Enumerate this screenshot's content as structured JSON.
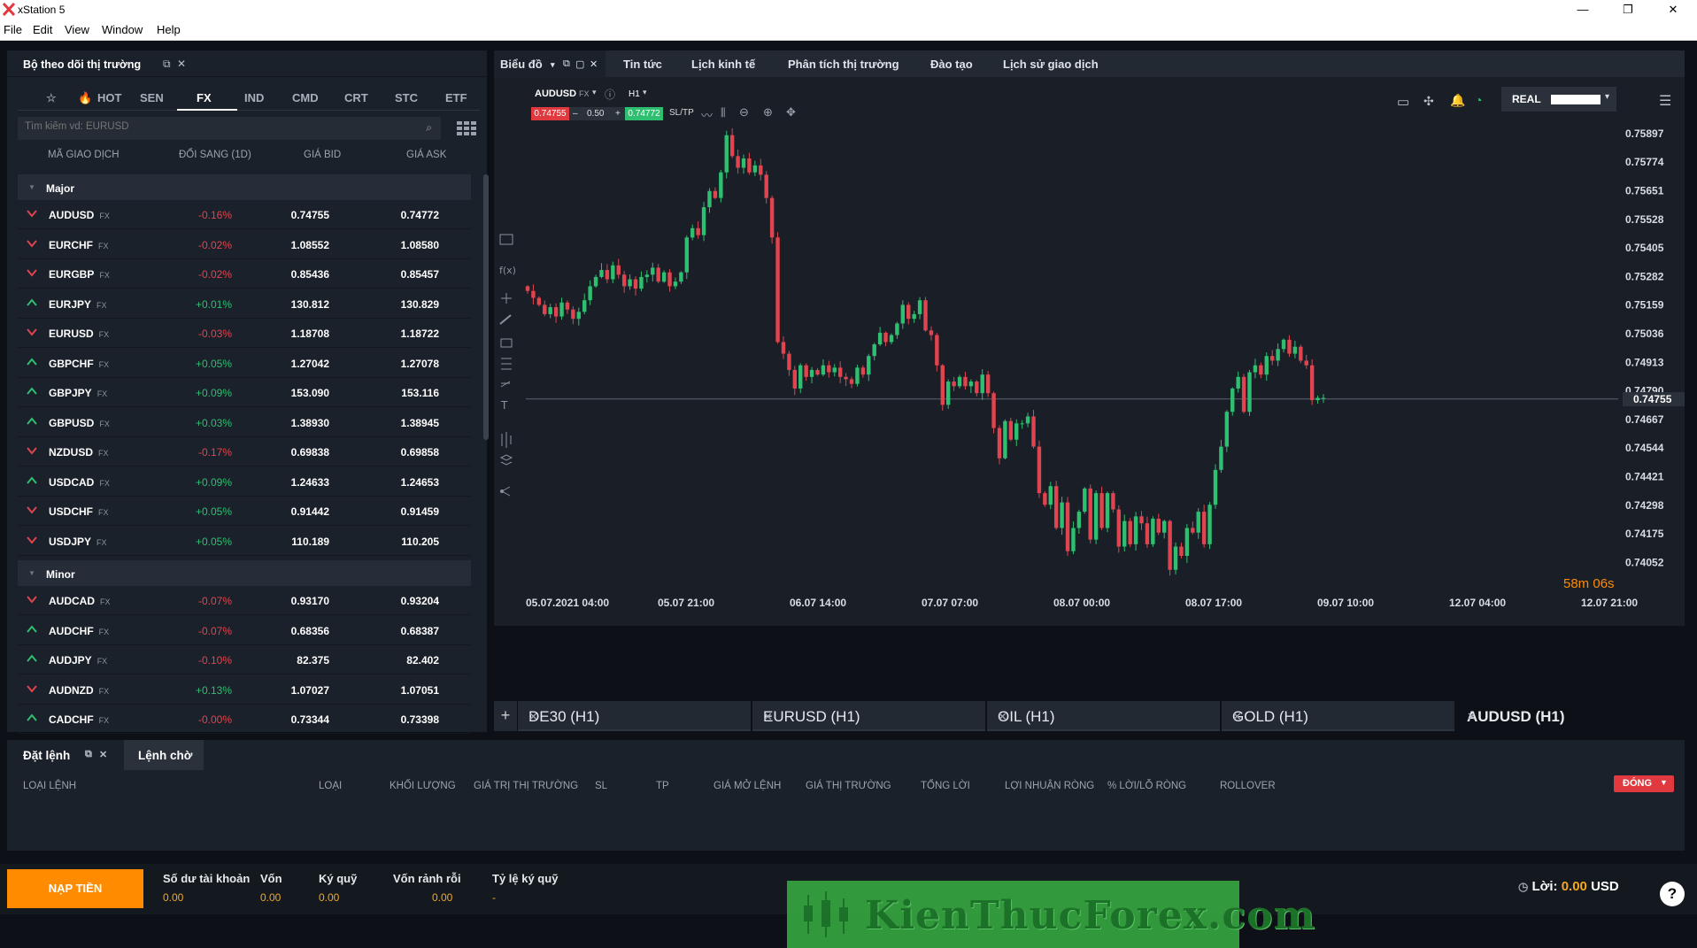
{
  "window": {
    "title": "xStation 5",
    "minimize": "—",
    "maximize": "❐",
    "close": "✕"
  },
  "menu": [
    "File",
    "Edit",
    "View",
    "Window",
    "Help"
  ],
  "watchlist": {
    "title": "Bộ theo dõi thị trường",
    "tabs": [
      "HOT",
      "SEN",
      "FX",
      "IND",
      "CMD",
      "CRT",
      "STC",
      "ETF"
    ],
    "active_tab": "FX",
    "search_placeholder": "Tìm kiếm vd: EURUSD",
    "columns": [
      "MÃ GIAO DỊCH",
      "ĐỔI SANG (1D)",
      "GIÁ BID",
      "GIÁ ASK"
    ],
    "groups": [
      {
        "name": "Major",
        "rows": [
          {
            "symbol": "AUDUSD",
            "type": "FX",
            "dir": "down",
            "change": "-0.16%",
            "bid": "0.74755",
            "ask": "0.74772"
          },
          {
            "symbol": "EURCHF",
            "type": "FX",
            "dir": "down",
            "change": "-0.02%",
            "bid": "1.08552",
            "ask": "1.08580"
          },
          {
            "symbol": "EURGBP",
            "type": "FX",
            "dir": "down",
            "change": "-0.02%",
            "bid": "0.85436",
            "ask": "0.85457"
          },
          {
            "symbol": "EURJPY",
            "type": "FX",
            "dir": "up",
            "change": "+0.01%",
            "bid": "130.812",
            "ask": "130.829"
          },
          {
            "symbol": "EURUSD",
            "type": "FX",
            "dir": "down",
            "change": "-0.03%",
            "bid": "1.18708",
            "ask": "1.18722"
          },
          {
            "symbol": "GBPCHF",
            "type": "FX",
            "dir": "up",
            "change": "+0.05%",
            "bid": "1.27042",
            "ask": "1.27078"
          },
          {
            "symbol": "GBPJPY",
            "type": "FX",
            "dir": "up",
            "change": "+0.09%",
            "bid": "153.090",
            "ask": "153.116"
          },
          {
            "symbol": "GBPUSD",
            "type": "FX",
            "dir": "up",
            "change": "+0.03%",
            "bid": "1.38930",
            "ask": "1.38945"
          },
          {
            "symbol": "NZDUSD",
            "type": "FX",
            "dir": "down",
            "change": "-0.17%",
            "bid": "0.69838",
            "ask": "0.69858"
          },
          {
            "symbol": "USDCAD",
            "type": "FX",
            "dir": "up",
            "change": "+0.09%",
            "bid": "1.24633",
            "ask": "1.24653"
          },
          {
            "symbol": "USDCHF",
            "type": "FX",
            "dir": "down",
            "change": "+0.05%",
            "bid": "0.91442",
            "ask": "0.91459"
          },
          {
            "symbol": "USDJPY",
            "type": "FX",
            "dir": "down",
            "change": "+0.05%",
            "bid": "110.189",
            "ask": "110.205"
          }
        ]
      },
      {
        "name": "Minor",
        "rows": [
          {
            "symbol": "AUDCAD",
            "type": "FX",
            "dir": "down",
            "change": "-0.07%",
            "bid": "0.93170",
            "ask": "0.93204"
          },
          {
            "symbol": "AUDCHF",
            "type": "FX",
            "dir": "up",
            "change": "-0.07%",
            "bid": "0.68356",
            "ask": "0.68387"
          },
          {
            "symbol": "AUDJPY",
            "type": "FX",
            "dir": "up",
            "change": "-0.10%",
            "bid": "82.375",
            "ask": "82.402"
          },
          {
            "symbol": "AUDNZD",
            "type": "FX",
            "dir": "down",
            "change": "+0.13%",
            "bid": "1.07027",
            "ask": "1.07051"
          },
          {
            "symbol": "CADCHF",
            "type": "FX",
            "dir": "up",
            "change": "-0.00%",
            "bid": "0.73344",
            "ask": "0.73398"
          }
        ]
      }
    ]
  },
  "chart_tabs": [
    "Biểu đồ",
    "Tin tức",
    "Lịch kinh tế",
    "Phân tích thị trường",
    "Đào tạo",
    "Lịch sử giao dịch"
  ],
  "account_mode": "REAL",
  "chart": {
    "symbol": "AUDUSD",
    "symbol_type": "FX",
    "timeframe": "H1",
    "sell_price": "0.74755",
    "volume": "0.50",
    "buy_price": "0.74772",
    "sltp": "SL/TP",
    "minus": "–",
    "plus": "+",
    "current_price": "0.74755",
    "countdown": "58m 06s",
    "y_ticks": [
      "0.75897",
      "0.75774",
      "0.75651",
      "0.75528",
      "0.75405",
      "0.75282",
      "0.75159",
      "0.75036",
      "0.74913",
      "0.74790",
      "0.74667",
      "0.74544",
      "0.74421",
      "0.74298",
      "0.74175",
      "0.74052"
    ],
    "x_ticks": [
      "05.07.2021 04:00",
      "05.07 21:00",
      "06.07 14:00",
      "07.07 07:00",
      "08.07 00:00",
      "08.07 17:00",
      "09.07 10:00",
      "12.07 04:00",
      "12.07 21:00"
    ]
  },
  "chart_data": {
    "type": "candlestick",
    "ylim": [
      0.74,
      0.7595
    ],
    "closes": [
      0.7522,
      0.7519,
      0.7516,
      0.7512,
      0.7515,
      0.7511,
      0.7517,
      0.7514,
      0.751,
      0.7513,
      0.7518,
      0.7524,
      0.7528,
      0.7531,
      0.7527,
      0.7533,
      0.7529,
      0.7524,
      0.7527,
      0.7523,
      0.7528,
      0.7529,
      0.7532,
      0.7526,
      0.753,
      0.7524,
      0.7526,
      0.753,
      0.7545,
      0.7549,
      0.7546,
      0.7558,
      0.7565,
      0.7562,
      0.7573,
      0.7589,
      0.758,
      0.7575,
      0.7579,
      0.7573,
      0.7576,
      0.7572,
      0.7562,
      0.7545,
      0.75,
      0.7495,
      0.7488,
      0.748,
      0.749,
      0.7485,
      0.7488,
      0.7486,
      0.749,
      0.7487,
      0.7489,
      0.7485,
      0.7484,
      0.7482,
      0.7489,
      0.7486,
      0.7494,
      0.7499,
      0.7504,
      0.75,
      0.7503,
      0.7508,
      0.7516,
      0.751,
      0.7512,
      0.7518,
      0.7505,
      0.7503,
      0.749,
      0.7473,
      0.7483,
      0.7481,
      0.7485,
      0.7481,
      0.7483,
      0.7478,
      0.7486,
      0.7478,
      0.7463,
      0.745,
      0.7466,
      0.7458,
      0.7465,
      0.7465,
      0.7468,
      0.7455,
      0.7435,
      0.743,
      0.7438,
      0.742,
      0.7431,
      0.741,
      0.742,
      0.7427,
      0.7437,
      0.7415,
      0.7435,
      0.742,
      0.7435,
      0.7428,
      0.7412,
      0.7423,
      0.7413,
      0.7425,
      0.7422,
      0.7413,
      0.7424,
      0.7418,
      0.7423,
      0.7402,
      0.7412,
      0.7408,
      0.742,
      0.7418,
      0.7427,
      0.7413,
      0.743,
      0.7445,
      0.7455,
      0.747,
      0.748,
      0.7485,
      0.747,
      0.7487,
      0.749,
      0.7486,
      0.7494,
      0.7492,
      0.7497,
      0.7501,
      0.7495,
      0.7498,
      0.7492,
      0.749,
      0.7475,
      0.7476,
      0.7476
    ]
  },
  "bottom_tabs": [
    {
      "label": "DE30 (H1)",
      "close": "✕"
    },
    {
      "label": "EURUSD (H1)",
      "close": "✕"
    },
    {
      "label": "OIL (H1)",
      "close": "✕"
    },
    {
      "label": "GOLD (H1)",
      "close": "✕"
    },
    {
      "label": "AUDUSD (H1)",
      "close": "✕"
    }
  ],
  "orders": {
    "tab_active": "Đặt lệnh",
    "tab_other": "Lệnh chờ",
    "columns": [
      "LOẠI LỆNH",
      "LOẠI",
      "KHỐI LƯỢNG",
      "GIÁ TRỊ THỊ TRƯỜNG",
      "SL",
      "TP",
      "GIÁ MỞ LỆNH",
      "GIÁ THỊ TRƯỜNG",
      "TỔNG LỜI",
      "LỢI NHUẬN RÒNG",
      "% LỜI/LỖ RÒNG",
      "ROLLOVER"
    ],
    "close_button": "ĐÓNG"
  },
  "footer": {
    "deposit": "NẠP TIỀN",
    "stats": [
      {
        "label": "Số dư tài khoản",
        "value": "0.00"
      },
      {
        "label": "Vốn",
        "value": "0.00"
      },
      {
        "label": "Ký quỹ",
        "value": "0.00"
      },
      {
        "label": "Vốn rảnh rỗi",
        "value": "0.00"
      },
      {
        "label": "Tỷ lệ ký quỹ",
        "value": "-"
      }
    ],
    "profit_label": "Lời:",
    "profit_value": "0.00",
    "profit_currency": "USD",
    "watermark": "KienThucForex.com",
    "help": "?"
  },
  "colors": {
    "up": "#2fbf71",
    "down": "#e0454f",
    "accent": "#ff8c00",
    "panel": "#1b212a"
  }
}
